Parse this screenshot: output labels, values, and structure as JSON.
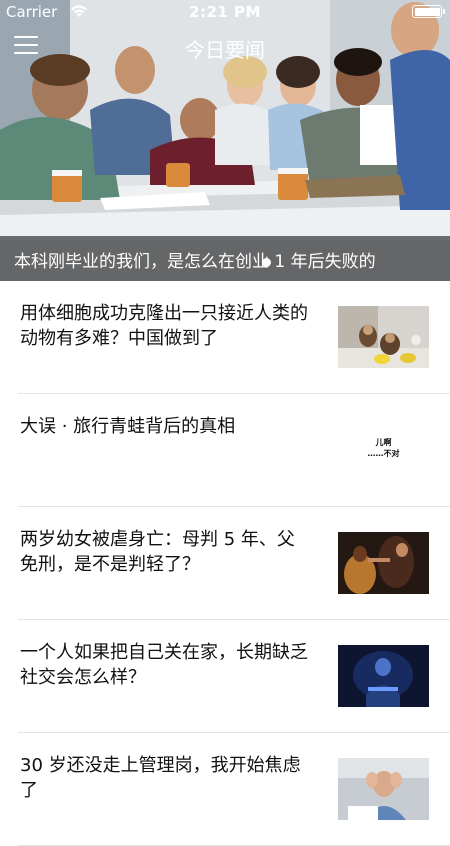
{
  "status_bar": {
    "carrier": "Carrier",
    "time": "2:21 PM",
    "battery_level": 1.0
  },
  "nav": {
    "title": "今日要闻",
    "menu_icon": "menu-icon"
  },
  "hero": {
    "caption": "本科刚毕业的我们，是怎么在创业 1 年后失败的",
    "photo": "office-team-meeting-photo"
  },
  "news": [
    {
      "title": "用体细胞成功克隆出一只接近人类的动物有多难？中国做到了",
      "thumb": "monkeys-photo"
    },
    {
      "title": "大误 · 旅行青蛙背后的真相",
      "thumb": "text-image",
      "thumb_lines": [
        "儿啊",
        "……不对"
      ]
    },
    {
      "title": "两岁幼女被虐身亡：母判 5 年、父免刑，是不是判轻了？",
      "thumb": "dark-scene-photo"
    },
    {
      "title": "一个人如果把自己关在家，长期缺乏社交会怎么样？",
      "thumb": "person-at-computer-photo"
    },
    {
      "title": "30 岁还没走上管理岗，我开始焦虑了",
      "thumb": "stressed-man-photo"
    }
  ]
}
